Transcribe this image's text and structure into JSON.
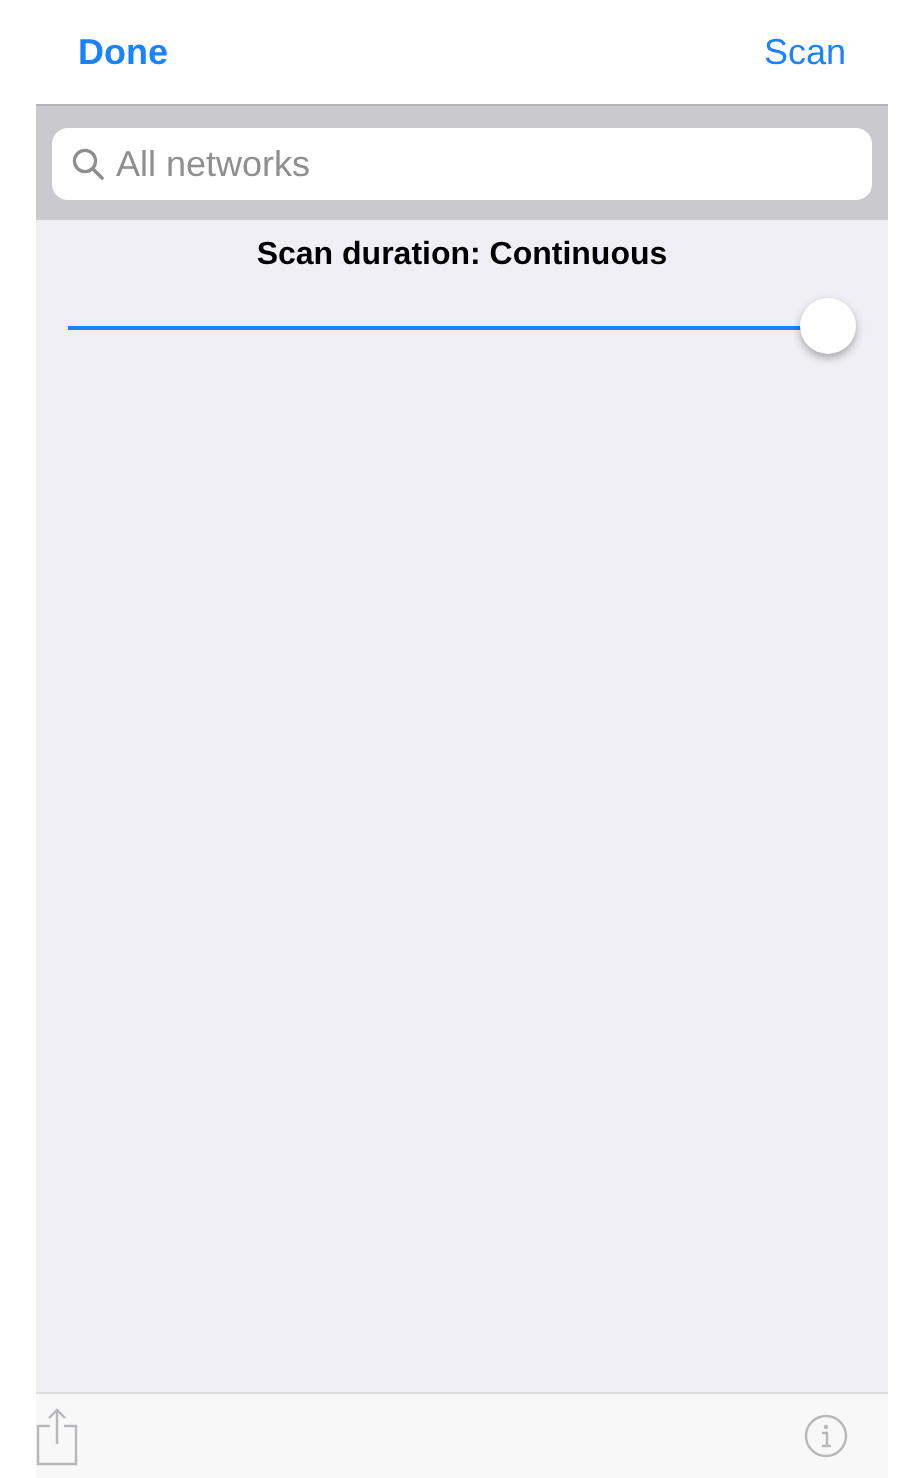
{
  "nav_bar": {
    "left_button": "Done",
    "right_button": "Scan"
  },
  "search": {
    "placeholder": "All networks"
  },
  "scan_duration": {
    "label": "Scan duration: Continuous",
    "level": 1
  }
}
